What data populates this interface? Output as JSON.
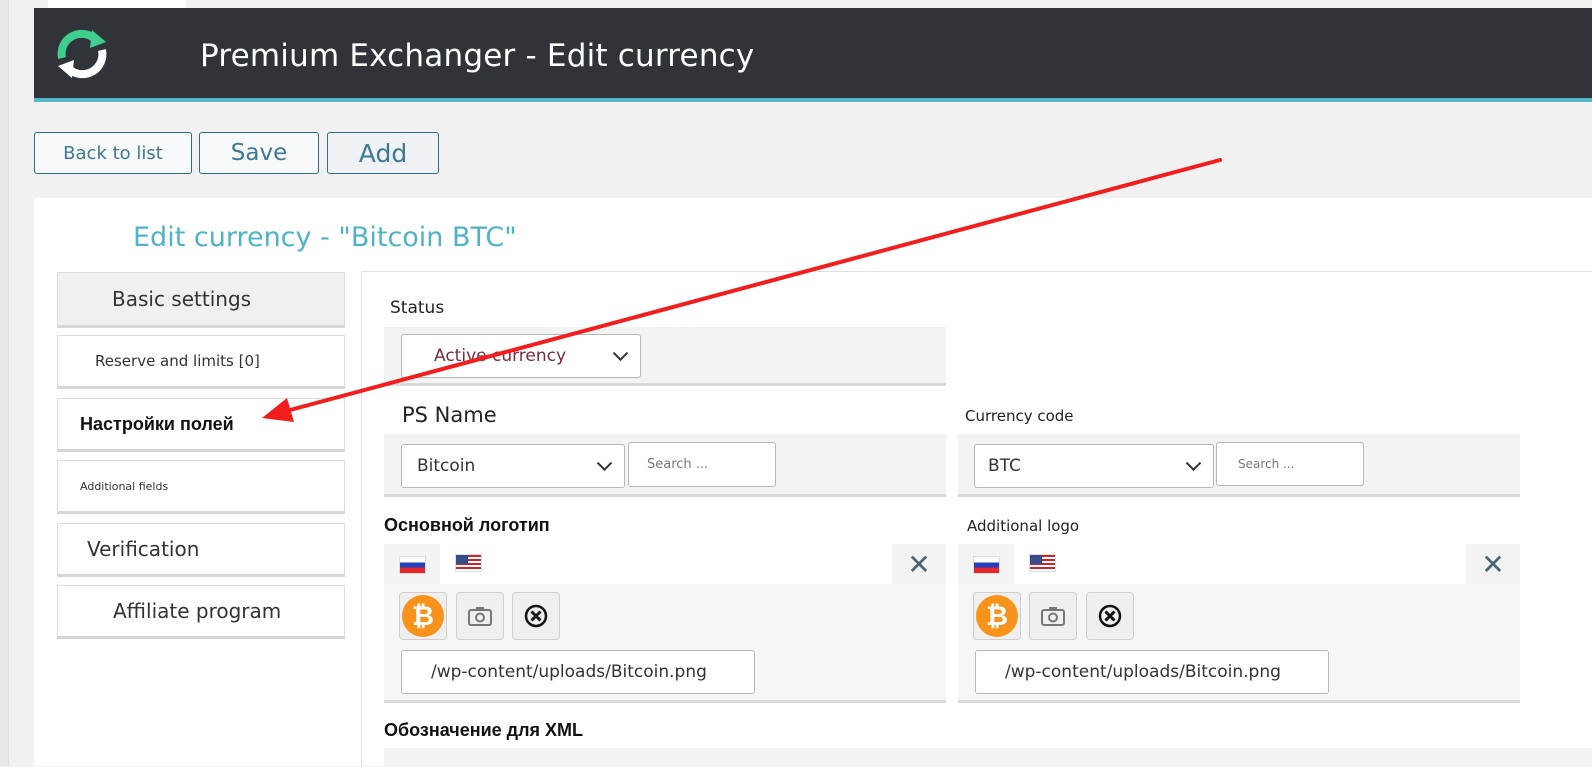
{
  "header": {
    "title": "Premium Exchanger - Edit currency",
    "logo_icon": "refresh-arrows-logo"
  },
  "toolbar": {
    "back_label": "Back to list",
    "save_label": "Save",
    "add_label": "Add"
  },
  "page": {
    "title": "Edit currency - \"Bitcoin BTC\""
  },
  "sidebar": {
    "items": [
      {
        "label": "Basic settings",
        "active": true
      },
      {
        "label": "Reserve and limits [0]"
      },
      {
        "label": "Настройки полей"
      },
      {
        "label": "Additional fields"
      },
      {
        "label": "Verification"
      },
      {
        "label": "Affiliate program"
      }
    ]
  },
  "form": {
    "status": {
      "label": "Status",
      "value": "Active currency"
    },
    "ps_name": {
      "label": "PS Name",
      "value": "Bitcoin",
      "search_placeholder": "Search ..."
    },
    "currency_code": {
      "label": "Currency code",
      "value": "BTC",
      "search_placeholder": "Search ..."
    },
    "main_logo": {
      "label": "Основной логотип",
      "path": "/wp-content/uploads/Bitcoin.png",
      "close_symbol": "✕"
    },
    "additional_logo": {
      "label": "Additional logo",
      "path": "/wp-content/uploads/Bitcoin.png",
      "close_symbol": "✕"
    },
    "xml_label": "Обозначение для XML"
  },
  "icons": {
    "bitcoin_glyph": "₿",
    "clear_glyph": "⊗"
  },
  "colors": {
    "header_bg": "#303438",
    "accent": "#4fb3c4",
    "annotation_arrow": "#f21e1e",
    "bitcoin": "#f7931a"
  }
}
